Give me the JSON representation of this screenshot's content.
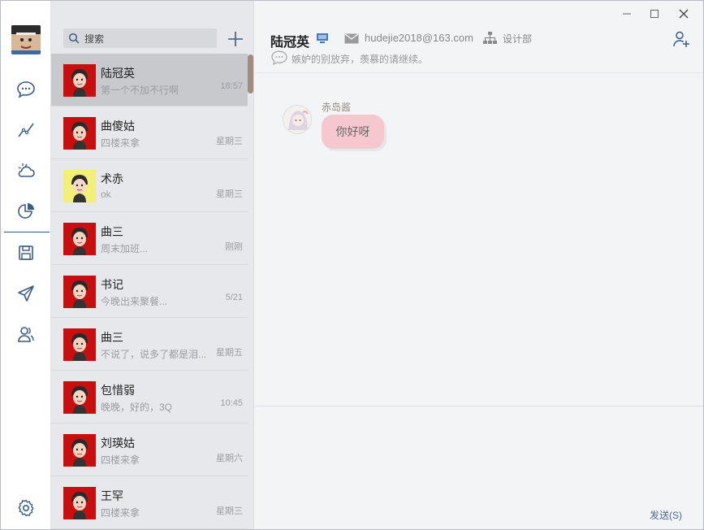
{
  "nav": {
    "items": [
      {
        "icon": "chat-bubble-icon"
      },
      {
        "icon": "trend-line-icon"
      },
      {
        "icon": "weather-cloud-icon"
      },
      {
        "icon": "pie-chart-icon"
      },
      {
        "icon": "floppy-disk-icon"
      },
      {
        "icon": "send-plane-icon"
      },
      {
        "icon": "contacts-icon"
      },
      {
        "icon": "gear-icon"
      }
    ]
  },
  "search": {
    "placeholder": "搜索"
  },
  "contacts": [
    {
      "name": "陆冠英",
      "message": "第一个不加不行啊",
      "time": "18:57",
      "avatar_bg": "#c80f0f"
    },
    {
      "name": "曲傻姑",
      "message": "四楼来拿",
      "time": "星期三",
      "avatar_bg": "#c80f0f"
    },
    {
      "name": "术赤",
      "message": "ok",
      "time": "星期三",
      "avatar_bg": "#f3f07a"
    },
    {
      "name": "曲三",
      "message": "周末加班...",
      "time": "刚刚",
      "avatar_bg": "#c80f0f"
    },
    {
      "name": "书记",
      "message": "今晚出来聚餐...",
      "time": "5/21",
      "avatar_bg": "#c80f0f"
    },
    {
      "name": "曲三",
      "message": "不说了，说多了都是泪...",
      "time": "星期五",
      "avatar_bg": "#c80f0f"
    },
    {
      "name": "包惜弱",
      "message": "晚晚，好的，3Q",
      "time": "10:45",
      "avatar_bg": "#c80f0f"
    },
    {
      "name": "刘瑛姑",
      "message": "四楼来拿",
      "time": "星期六",
      "avatar_bg": "#c80f0f"
    },
    {
      "name": "王罕",
      "message": "四楼来拿",
      "time": "星期三",
      "avatar_bg": "#c80f0f"
    }
  ],
  "chat": {
    "title": "陆冠英",
    "email": "hudejie2018@163.com",
    "department": "设计部",
    "signature": "嫉妒的别放弃，羡慕的请继续。",
    "messages": [
      {
        "sender": "赤岛酱",
        "text": "你好呀"
      }
    ],
    "send_label": "发送(S)"
  },
  "colors": {
    "accent": "#3b5c84",
    "bubble": "#f5c8d0",
    "avatar_red": "#c80f0f"
  }
}
